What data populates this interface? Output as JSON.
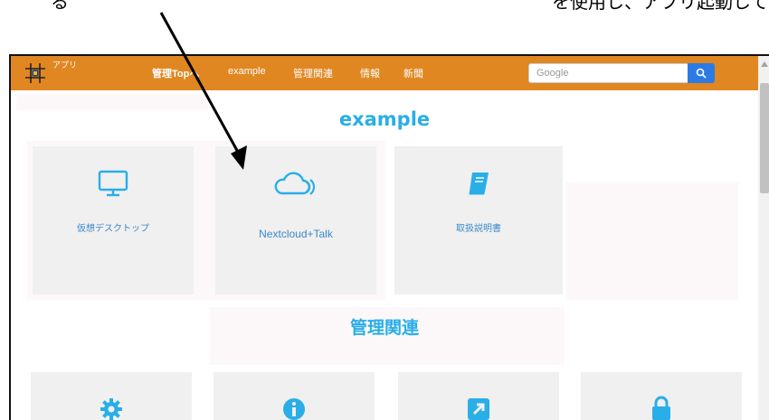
{
  "caption": {
    "text_left": "る",
    "text_right": "を使用し、アプリ起動して"
  },
  "navbar": {
    "app_name": "アプリ",
    "items": [
      {
        "label": "管理Topへ"
      },
      {
        "label": "example"
      },
      {
        "label": "管理関連"
      },
      {
        "label": "情報"
      },
      {
        "label": "新聞"
      }
    ],
    "search_placeholder": "Google",
    "accent_color": "#e08722",
    "search_button_color": "#2c7be5"
  },
  "sections": [
    {
      "title": "example",
      "title_color": "#29aee8",
      "cards": [
        {
          "label": "仮想デスクトップ",
          "icon": "monitor-icon"
        },
        {
          "label": "Nextcloud+Talk",
          "icon": "cloud-wifi-icon"
        },
        {
          "label": "取扱説明書",
          "icon": "book-icon"
        }
      ]
    },
    {
      "title": "管理関連",
      "title_color": "#29aee8",
      "cards": [
        {
          "icon": "gear-icon"
        },
        {
          "icon": "info-icon"
        },
        {
          "icon": "external-link-icon"
        },
        {
          "icon": "lock-icon"
        }
      ]
    }
  ],
  "card_label_color": "#3a89c9",
  "card_icon_color": "#29aee8"
}
